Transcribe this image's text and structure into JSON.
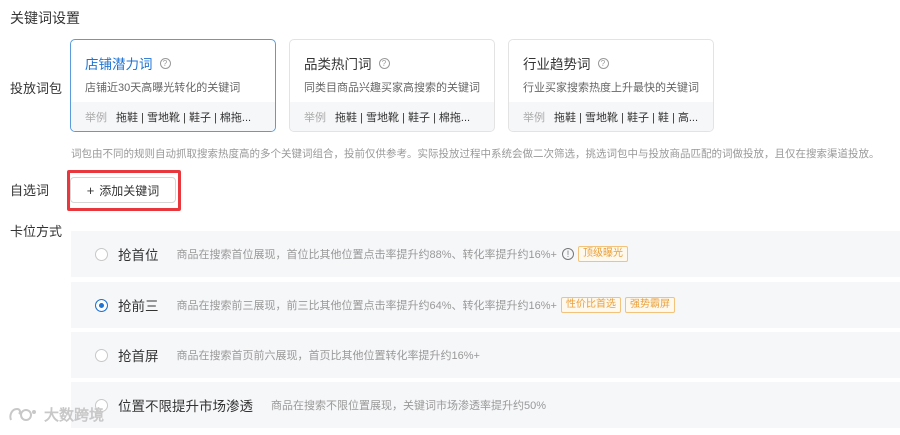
{
  "section_title": "关键词设置",
  "labels": {
    "package": "投放词包",
    "custom": "自选词",
    "bid_mode": "卡位方式"
  },
  "packages": [
    {
      "title": "店铺潜力词",
      "desc": "店铺近30天高曝光转化的关键词",
      "example_label": "举例",
      "keywords": "拖鞋 | 雪地靴 | 鞋子 | 棉拖...",
      "selected": true
    },
    {
      "title": "品类热门词",
      "desc": "同类目商品兴趣买家高搜索的关键词",
      "example_label": "举例",
      "keywords": "拖鞋 | 雪地靴 | 鞋子 | 棉拖...",
      "selected": false
    },
    {
      "title": "行业趋势词",
      "desc": "行业买家搜索热度上升最快的关键词",
      "example_label": "举例",
      "keywords": "拖鞋 | 雪地靴 | 鞋子 | 鞋 | 高...",
      "selected": false
    }
  ],
  "help_glyph": "?",
  "note": "词包由不同的规则自动抓取搜索热度高的多个关键词组合，投前仅供参考。实际投放过程中系统会做二次筛选，挑选词包中与投放商品匹配的词做投放，且仅在搜索渠道投放。",
  "add_button": {
    "plus": "+",
    "label": "添加关键词"
  },
  "bid_options": [
    {
      "name": "抢首位",
      "desc": "商品在搜索首位展现，首位比其他位置点击率提升约88%、转化率提升约16%+",
      "info": "!",
      "tags": [
        "顶级曝光"
      ],
      "checked": false
    },
    {
      "name": "抢前三",
      "desc": "商品在搜索前三展现，前三比其他位置点击率提升约64%、转化率提升约16%+",
      "tags": [
        "性价比首选",
        "强势霸屏"
      ],
      "checked": true
    },
    {
      "name": "抢首屏",
      "desc": "商品在搜索首页前六展现，首页比其他位置转化率提升约16%+",
      "tags": [],
      "checked": false
    },
    {
      "name": "位置不限提升市场渗透",
      "desc": "商品在搜索不限位置展现，关键词市场渗透率提升约50%",
      "tags": [],
      "checked": false
    }
  ],
  "watermark": {
    "text": "大数跨境"
  },
  "colors": {
    "accent": "#1f73d1",
    "highlight": "#e8383d",
    "tag": "#e8a03c"
  }
}
